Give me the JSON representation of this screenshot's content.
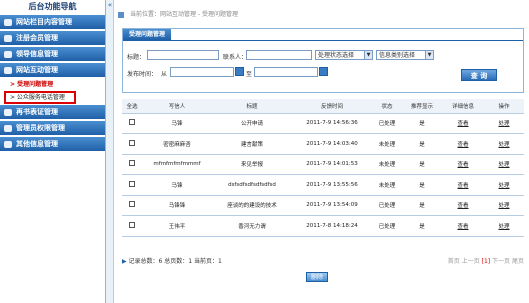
{
  "sidebar": {
    "title": "后台功能导航",
    "items": [
      {
        "label": "网站栏目内容管理",
        "icon": "globe-icon"
      },
      {
        "label": "注册会员管理",
        "icon": "users-icon"
      },
      {
        "label": "领导信息管理",
        "icon": "user-icon"
      },
      {
        "label": "网站互动管理",
        "icon": "chat-icon"
      }
    ],
    "subitems": [
      {
        "label": "> 受理问题管理"
      },
      {
        "label": "> 公众服务电话管理"
      }
    ],
    "items2": [
      {
        "label": "再书表证管理",
        "icon": "book-icon"
      },
      {
        "label": "管理员权限管理",
        "icon": "admin-icon"
      },
      {
        "label": "其他信息管理",
        "icon": "info-icon"
      }
    ]
  },
  "breadcrumb": "当前位置：网站互动管理 - 受理问题管理",
  "panel": {
    "tab": "受理问题管理",
    "title_label": "标题：",
    "contact_label": "联系人：",
    "status_select": "处理状态选择",
    "type_select": "信息类别选择",
    "time_label": "发布时间：",
    "from_label": "从",
    "to_label": "至",
    "search_button": "查 询"
  },
  "table": {
    "headers": [
      "全选",
      "写信人",
      "标题",
      "反馈时间",
      "状态",
      "推荐显示",
      "详细信息",
      "操作"
    ],
    "rows": [
      {
        "writer": "马锋",
        "title": "公开申请",
        "time": "2011-7-9 14:56:36",
        "status": "已处理",
        "status_red": false,
        "recommend": "是",
        "detail": "查看",
        "op": "处理"
      },
      {
        "writer": "密密麻麻咨",
        "title": "建言献策",
        "time": "2011-7-9 14:03:40",
        "status": "未处理",
        "status_red": true,
        "recommend": "是",
        "detail": "查看",
        "op": "处理"
      },
      {
        "writer": "mfmfmfmfmmmf",
        "title": "来见举报",
        "time": "2011-7-9 14:01:53",
        "status": "未处理",
        "status_red": true,
        "recommend": "是",
        "detail": "查看",
        "op": "处理"
      },
      {
        "writer": "马锋",
        "title": "dsfsdfsdfsdfsdfsd",
        "time": "2011-7-9 13:55:56",
        "status": "未处理",
        "status_red": true,
        "recommend": "是",
        "detail": "查看",
        "op": "处理"
      },
      {
        "writer": "马锋锋",
        "title": "座谈的的建设的技术",
        "time": "2011-7-9 13:54:09",
        "status": "已处理",
        "status_red": false,
        "recommend": "是",
        "detail": "查看",
        "op": "处理"
      },
      {
        "writer": "王伟平",
        "title": "香河无力谓",
        "time": "2011-7-8 14:18:24",
        "status": "已处理",
        "status_red": false,
        "recommend": "是",
        "detail": "查看",
        "op": "处理"
      }
    ]
  },
  "footer": {
    "summary": "记录总数：6 总页数：1 当前页：1",
    "pager": [
      "首页",
      "上一页",
      "[1]",
      "下一页",
      "尾页"
    ]
  },
  "delete_button": "删除",
  "colors": {
    "brand": "#1f5fa8",
    "alert": "#d00000",
    "link": "#1a5fb4"
  }
}
